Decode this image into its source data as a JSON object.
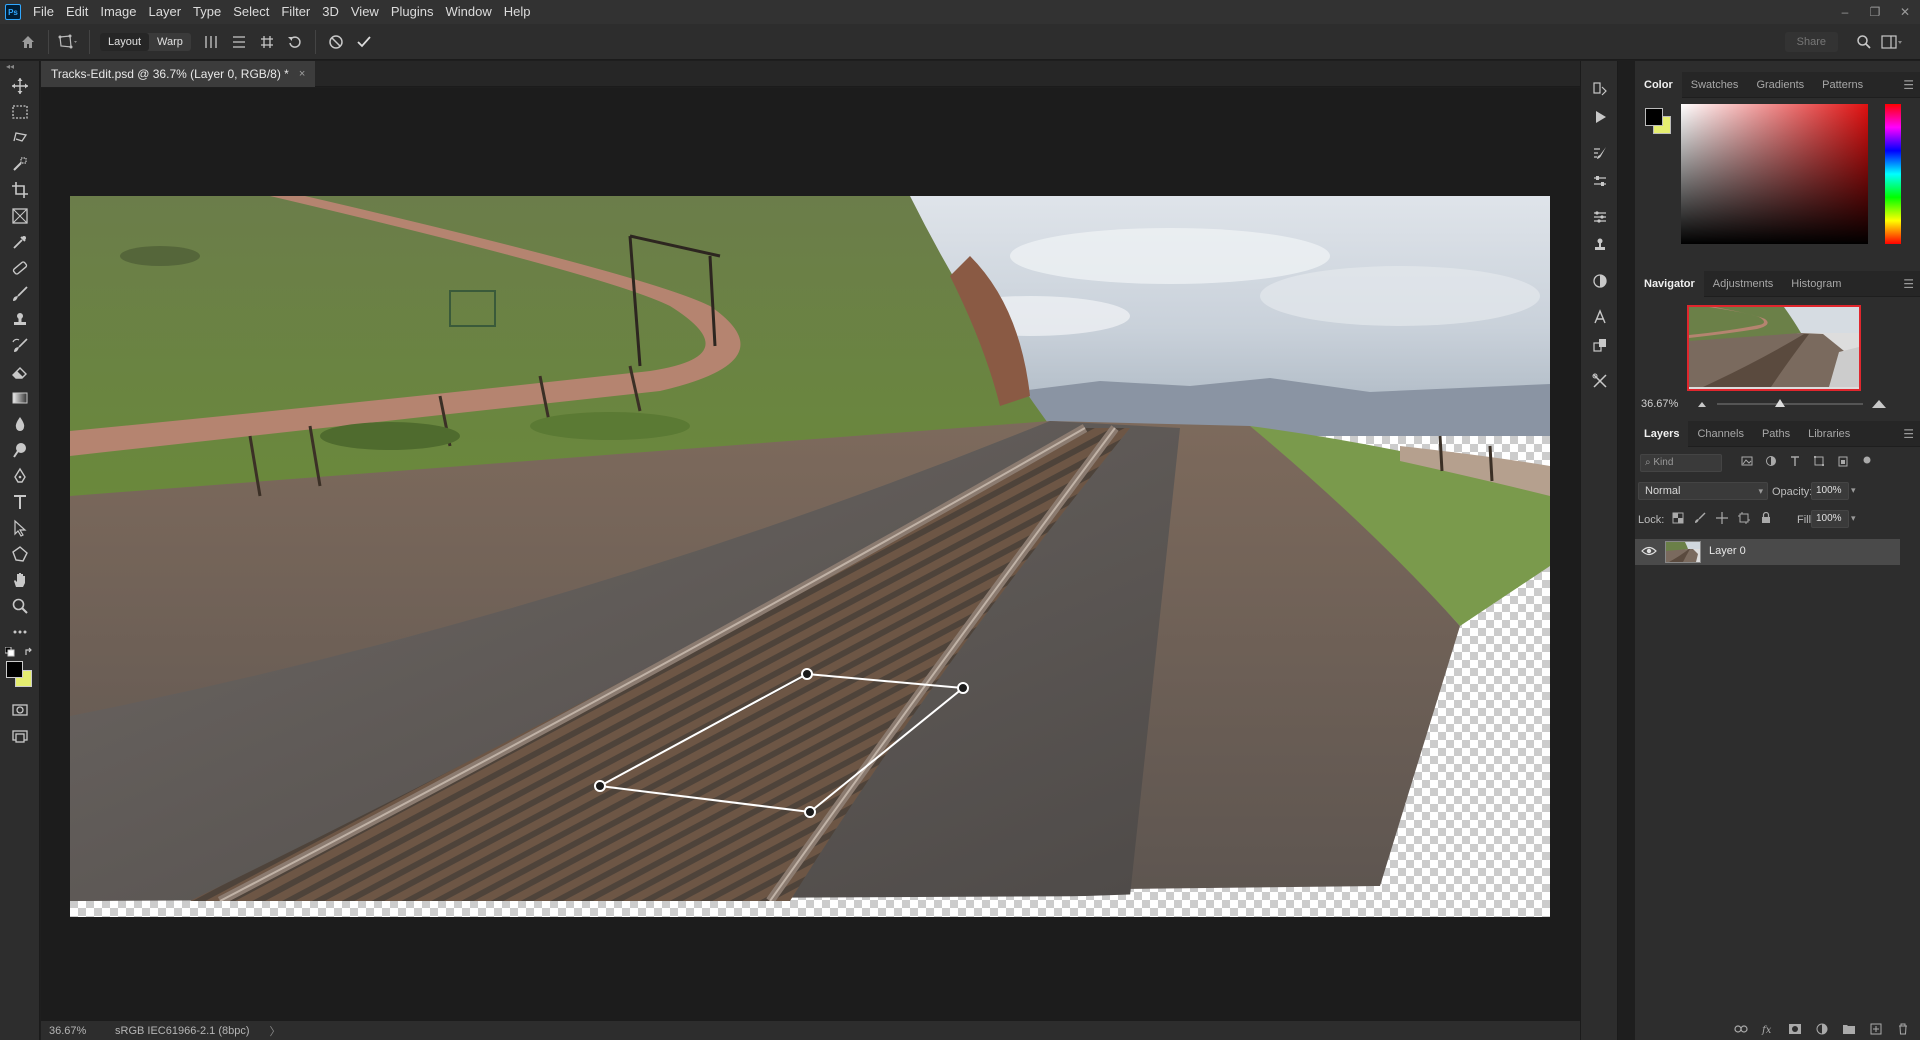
{
  "app": {
    "logo_text": "Ps"
  },
  "menu": [
    "File",
    "Edit",
    "Image",
    "Layer",
    "Type",
    "Select",
    "Filter",
    "3D",
    "View",
    "Plugins",
    "Window",
    "Help"
  ],
  "window_controls": {
    "minimize": "–",
    "restore": "❐",
    "close": "✕"
  },
  "options_bar": {
    "mode_layout": "Layout",
    "mode_warp": "Warp",
    "share_label": "Share"
  },
  "document": {
    "tab_title": "Tracks-Edit.psd @ 36.7% (Layer 0, RGB/8) *",
    "tab_close": "×"
  },
  "status_bar": {
    "zoom": "36.67%",
    "color_profile": "sRGB IEC61966-2.1 (8bpc)",
    "arrow": "〉"
  },
  "color_panel": {
    "tabs": [
      "Color",
      "Swatches",
      "Gradients",
      "Patterns"
    ],
    "active_tab": "Color",
    "foreground_color": "#000000",
    "background_color": "#e5ee70"
  },
  "navigator_panel": {
    "tabs": [
      "Navigator",
      "Adjustments",
      "Histogram"
    ],
    "active_tab": "Navigator",
    "zoom": "36.67%"
  },
  "layers_panel": {
    "tabs": [
      "Layers",
      "Channels",
      "Paths",
      "Libraries"
    ],
    "active_tab": "Layers",
    "filter_placeholder": "Kind",
    "blend_mode": "Normal",
    "opacity_label": "Opacity:",
    "opacity_value": "100%",
    "lock_label": "Lock:",
    "fill_label": "Fill:",
    "fill_value": "100%",
    "layers": [
      {
        "name": "Layer 0",
        "visible": true
      }
    ]
  },
  "panel_menu_icon": "☰",
  "colors": {
    "accent": "#31a8ff",
    "navigator_frame": "#e0262d",
    "warp_handles": "#ffffff"
  }
}
